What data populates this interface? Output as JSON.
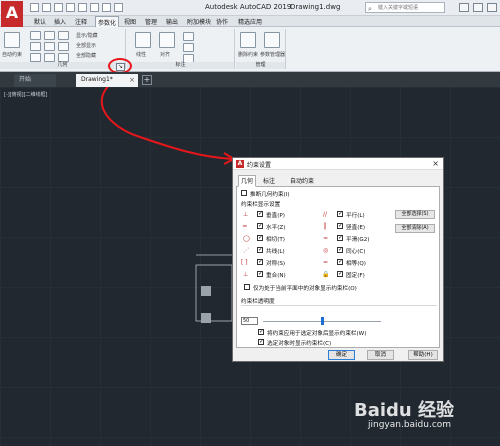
{
  "app": {
    "logo": "A",
    "title": "Autodesk AutoCAD 2019",
    "document": "Drawing1.dwg",
    "search_placeholder": "键入关键字或短语"
  },
  "menu_tabs": [
    "默认",
    "插入",
    "注释",
    "参数化",
    "视图",
    "管理",
    "输出",
    "附加模块",
    "协作",
    "精选应用"
  ],
  "active_menu_tab": "参数化",
  "ribbon": {
    "panels": [
      {
        "label": "几何"
      },
      {
        "label": "标注"
      },
      {
        "label": "管理"
      }
    ],
    "labels": {
      "auto_constrain": "自动约束",
      "show_hide": "显示/隐藏",
      "show_all": "全部显示",
      "hide_all": "全部隐藏",
      "linear": "线性",
      "aligned": "对齐",
      "delete_constraints": "删除约束",
      "parameters_manager": "参数管理器"
    }
  },
  "file_tabs": {
    "start": "开始",
    "drawing": "Drawing1*",
    "close": "×",
    "add": "+"
  },
  "canvas": {
    "viewport_label": "[-][俯视][二维线框]"
  },
  "dialog": {
    "title": "约束设置",
    "close": "×",
    "tabs": [
      "几何",
      "标注",
      "自动约束"
    ],
    "infer_constraints": "推断几何约束(I)",
    "group_title": "约束栏显示设置",
    "constraints": [
      {
        "label": "垂直(P)",
        "glyph": "⊥",
        "checked": true
      },
      {
        "label": "水平(Z)",
        "glyph": "═",
        "checked": true
      },
      {
        "label": "相切(T)",
        "glyph": "◯",
        "checked": true
      },
      {
        "label": "共线(L)",
        "glyph": "⋰",
        "checked": true
      },
      {
        "label": "对称(S)",
        "glyph": "[ ]",
        "checked": true
      },
      {
        "label": "重合(N)",
        "glyph": "⊥",
        "checked": true
      },
      {
        "label": "平行(L)",
        "glyph": "//",
        "checked": true
      },
      {
        "label": "竖直(E)",
        "glyph": "║",
        "checked": true
      },
      {
        "label": "平滑(G2)",
        "glyph": "≈",
        "checked": true
      },
      {
        "label": "同心(C)",
        "glyph": "◎",
        "checked": true
      },
      {
        "label": "相等(Q)",
        "glyph": "=",
        "checked": true
      },
      {
        "label": "固定(F)",
        "glyph": "🔒",
        "checked": true
      }
    ],
    "select_all": "全部选择(S)",
    "clear_all": "全部清除(A)",
    "only_current_plane": "仅为处于当前平面中的对象显示约束栏(O)",
    "opacity_label": "约束栏透明度",
    "opacity_value": "50",
    "opacity_fraction": 0.5,
    "apply_after_constraint": "将约束应用于选定对象后显示约束栏(W)",
    "show_when_selected": "选定对象时显示约束栏(C)",
    "ok": "确定",
    "cancel": "取消",
    "help": "帮助(H)"
  },
  "watermark": {
    "brand": "Baidu 经验",
    "url": "jingyan.baidu.com"
  },
  "colors": {
    "canvas": "#212830",
    "annotation": "#e5171b",
    "brand": "#c72a2a"
  }
}
